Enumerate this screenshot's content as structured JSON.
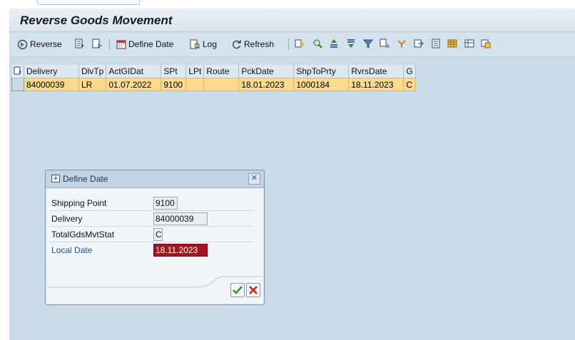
{
  "window": {
    "title": "Reverse Goods Movement"
  },
  "toolbar": {
    "reverse_label": "Reverse",
    "define_date_label": "Define Date",
    "log_label": "Log",
    "refresh_label": "Refresh"
  },
  "grid": {
    "columns": [
      "Delivery",
      "DlvTp",
      "ActGIDat",
      "SPt",
      "LPt",
      "Route",
      "PckDate",
      "ShpToPrty",
      "RvrsDate",
      "G"
    ],
    "rows": [
      [
        "84000039",
        "LR",
        "01.07.2022",
        "9100",
        "",
        "",
        "18.01.2023",
        "1000184",
        "18.11.2023",
        "C"
      ]
    ]
  },
  "dialog": {
    "title": "Define Date",
    "fields": [
      {
        "label": "Shipping Point",
        "value": "9100"
      },
      {
        "label": "Delivery",
        "value": "84000039"
      },
      {
        "label": "TotalGdsMvtStat",
        "value": "C"
      },
      {
        "label": "Local Date",
        "value": "18.11.2023"
      }
    ]
  },
  "colors": {
    "error_field": "#a8141d",
    "row_highlight": "#fbd98d",
    "background": "#ccdbe8"
  }
}
